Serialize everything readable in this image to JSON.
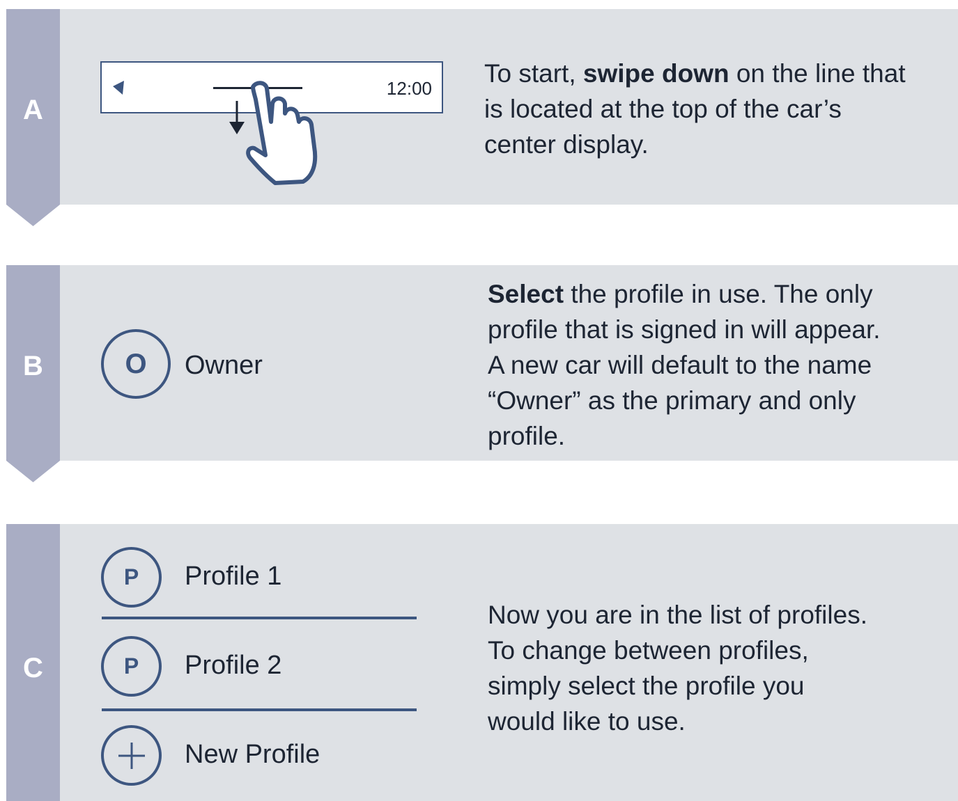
{
  "colors": {
    "panel": "#dee1e5",
    "tab": "#a9adc4",
    "accent": "#3d5680",
    "text": "#1d2533"
  },
  "steps": {
    "a": {
      "letter": "A",
      "screen": {
        "time": "12:00",
        "icons": [
          "nav-arrow-icon",
          "handle-line",
          "down-arrow-icon",
          "hand-pointer-icon"
        ]
      },
      "desc": {
        "pre": "To start, ",
        "bold": "swipe down",
        "post": " on the line that is located at the top of the car’s center display."
      }
    },
    "b": {
      "letter": "B",
      "profile": {
        "initial": "O",
        "name": "Owner"
      },
      "desc": {
        "bold": "Select",
        "post": " the profile in use. The only profile that is signed in will appear. A new car will default to the name “Owner” as the primary and only profile."
      }
    },
    "c": {
      "letter": "C",
      "profiles": [
        {
          "initial": "P",
          "name": "Profile 1"
        },
        {
          "initial": "P",
          "name": "Profile 2"
        }
      ],
      "new_profile": {
        "name": "New Profile",
        "icon": "plus-icon"
      },
      "desc": "Now you are in the list of profiles. To change between profiles, simply select the profile you would like to use."
    }
  }
}
